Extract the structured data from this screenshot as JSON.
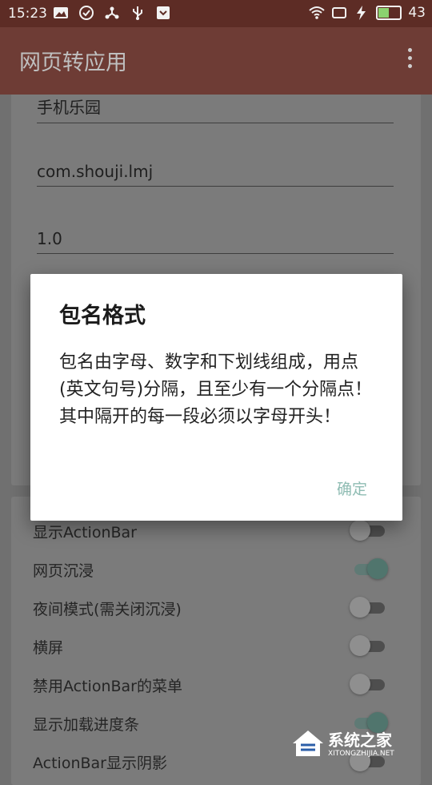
{
  "status_bar": {
    "time": "15:23",
    "battery": "43",
    "icons_left": [
      "image-icon",
      "check-circle-icon",
      "share-icon",
      "usb-icon",
      "shield-icon"
    ],
    "icons_right": [
      "wifi-icon",
      "square-icon",
      "lightning-icon",
      "battery-icon"
    ]
  },
  "app_bar": {
    "title": "网页转应用",
    "menu_icon": "more-vert-icon"
  },
  "form": {
    "app_name": "手机乐园",
    "package_name": "com.shouji.lmj",
    "version": "1.0"
  },
  "dialog": {
    "title": "包名格式",
    "message": "包名由字母、数字和下划线组成，用点(英文句号)分隔，且至少有一个分隔点！其中隔开的每一段必须以字母开头！",
    "ok_label": "确定"
  },
  "settings": [
    {
      "label": "显示ActionBar",
      "on": false
    },
    {
      "label": "网页沉浸",
      "on": true
    },
    {
      "label": "夜间模式(需关闭沉浸)",
      "on": false
    },
    {
      "label": "横屏",
      "on": false
    },
    {
      "label": "禁用ActionBar的菜单",
      "on": false
    },
    {
      "label": "显示加载进度条",
      "on": true
    },
    {
      "label": "ActionBar显示阴影",
      "on": false
    }
  ],
  "watermark": {
    "text": "系统之家",
    "url": "XITONGZHIJIA.NET"
  },
  "colors": {
    "status_bar": "#5d2c25",
    "app_bar": "#6e3c35",
    "accent": "#50756d",
    "dialog_button": "#8fbcb3"
  }
}
